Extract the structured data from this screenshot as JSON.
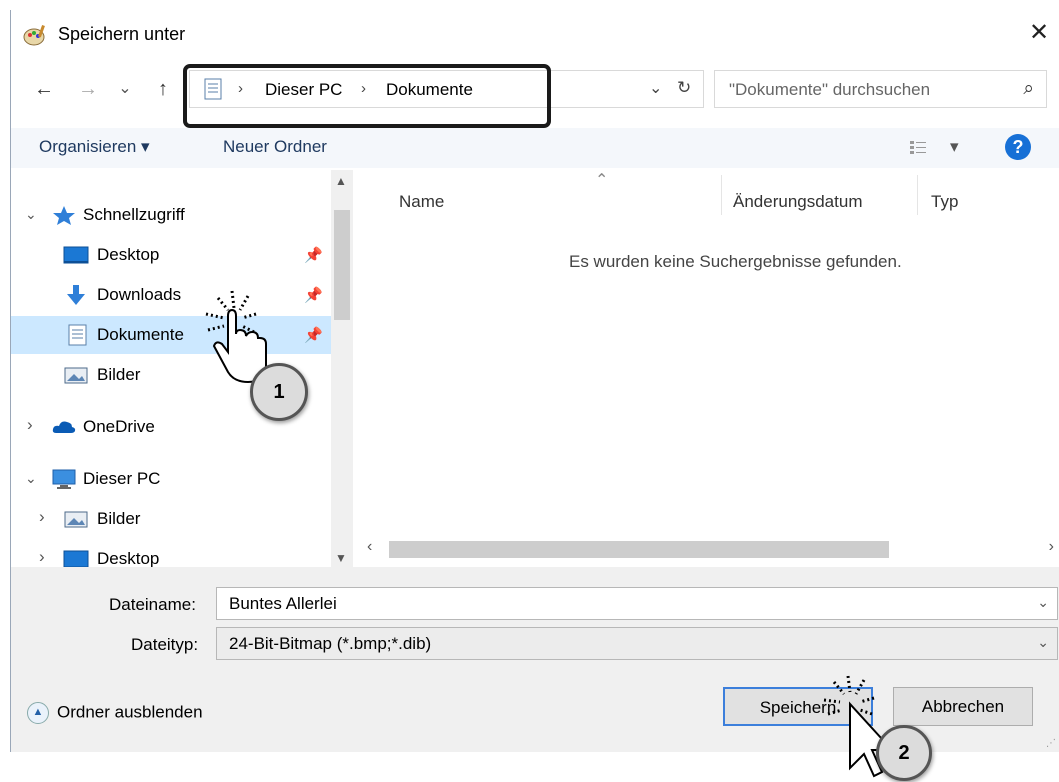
{
  "window": {
    "title": "Speichern unter",
    "close_glyph": "✕"
  },
  "nav": {
    "back": "←",
    "forward": "→",
    "recent": "⌄",
    "up": "↑",
    "breadcrumb": [
      "Dieser PC",
      "Dokumente"
    ],
    "separator": "›",
    "dropdown": "⌄",
    "refresh": "↻",
    "search_placeholder": "\"Dokumente\" durchsuchen",
    "search_glyph": "⌕"
  },
  "toolbar": {
    "organize": "Organisieren ▾",
    "new_folder": "Neuer Ordner",
    "view": "▾",
    "help": "?"
  },
  "tree": [
    {
      "label": "Schnellzugriff",
      "chev": "⌄",
      "icon": "star-icon",
      "pinned": false,
      "selected": false
    },
    {
      "label": "Desktop",
      "chev": "",
      "icon": "desktop-icon",
      "pinned": true,
      "selected": false
    },
    {
      "label": "Downloads",
      "chev": "",
      "icon": "download-icon",
      "pinned": true,
      "selected": false
    },
    {
      "label": "Dokumente",
      "chev": "",
      "icon": "document-icon",
      "pinned": true,
      "selected": true
    },
    {
      "label": "Bilder",
      "chev": "",
      "icon": "pictures-icon",
      "pinned": true,
      "selected": false
    },
    {
      "label": "OneDrive",
      "chev": "›",
      "icon": "cloud-icon",
      "pinned": false,
      "selected": false
    },
    {
      "label": "Dieser PC",
      "chev": "⌄",
      "icon": "computer-icon",
      "pinned": false,
      "selected": false
    },
    {
      "label": "Bilder",
      "chev": "›",
      "icon": "pictures-icon",
      "pinned": false,
      "selected": false
    },
    {
      "label": "Desktop",
      "chev": "›",
      "icon": "desktop-icon",
      "pinned": false,
      "selected": false
    }
  ],
  "columns": {
    "name": "Name",
    "date": "Änderungsdatum",
    "type": "Typ"
  },
  "empty_message": "Es wurden keine Suchergebnisse gefunden.",
  "form": {
    "filename_label": "Dateiname:",
    "filename_value": "Buntes Allerlei",
    "filetype_label": "Dateityp:",
    "filetype_value": "24-Bit-Bitmap (*.bmp;*.dib)"
  },
  "footer": {
    "hide_folders": "Ordner ausblenden",
    "save": "Speichern",
    "cancel": "Abbrechen"
  },
  "annotations": {
    "step1": "1",
    "step2": "2"
  }
}
